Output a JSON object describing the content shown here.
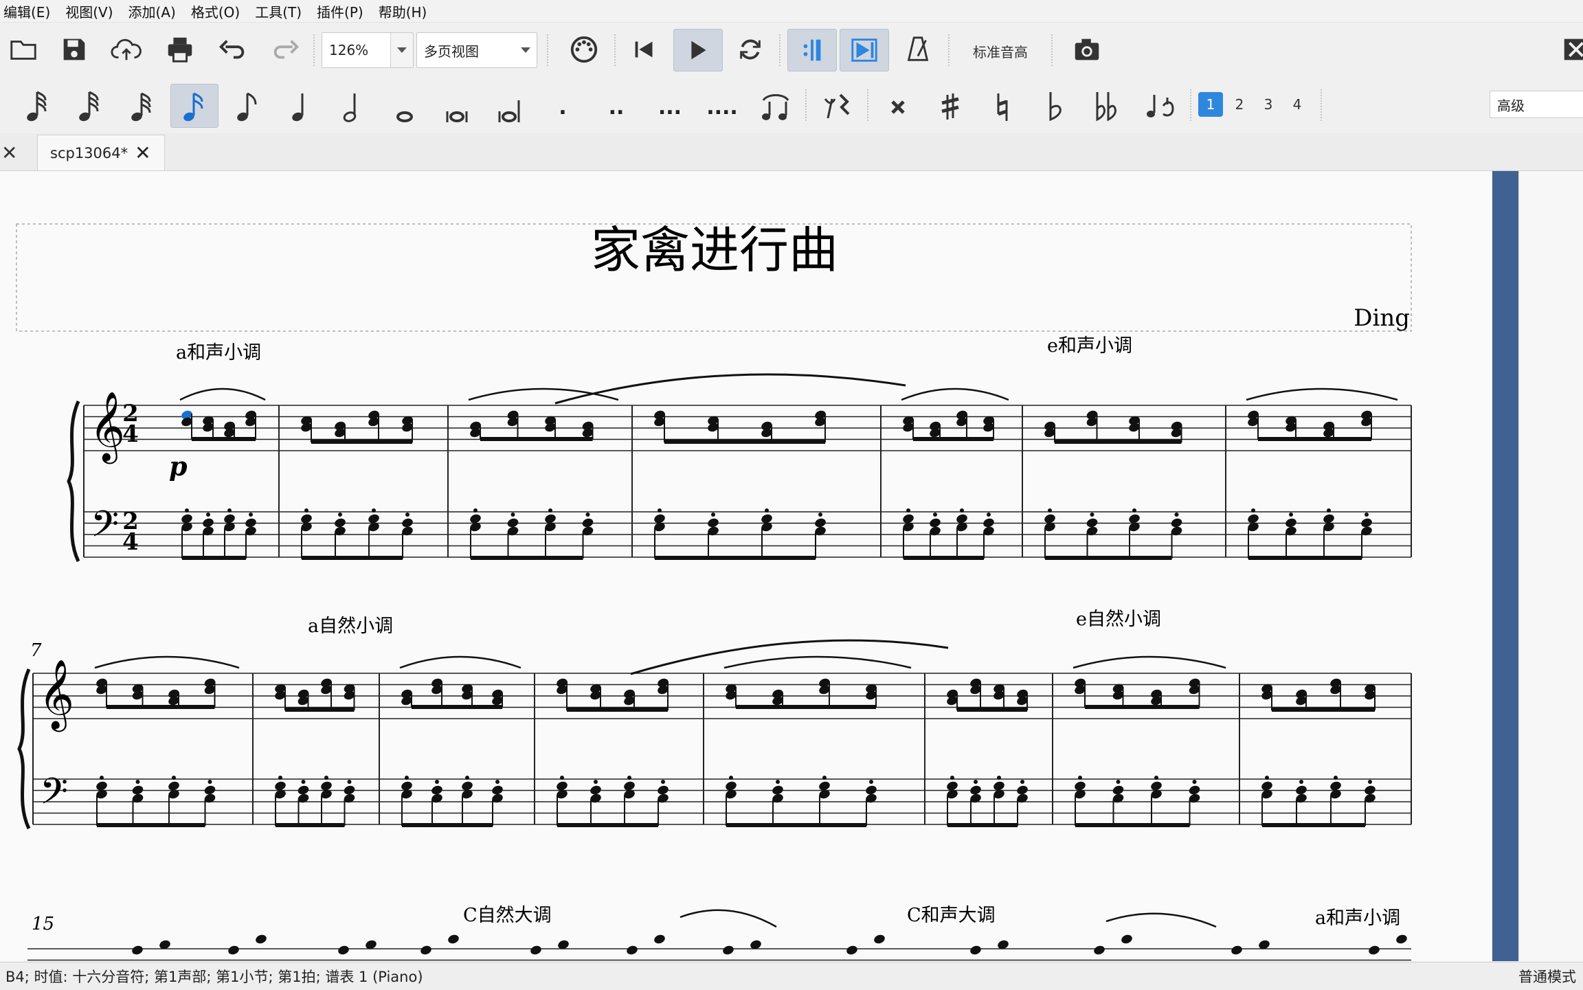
{
  "menubar": {
    "items": [
      "编辑(E)",
      "视图(V)",
      "添加(A)",
      "格式(O)",
      "工具(T)",
      "插件(P)",
      "帮助(H)"
    ]
  },
  "toolbar": {
    "zoom": "126%",
    "view_mode": "多页视图",
    "pitch_label": "标准音高"
  },
  "note_toolbar": {
    "dots": [
      ".",
      "..",
      "...",
      "...."
    ],
    "voices": [
      "1",
      "2",
      "3",
      "4"
    ],
    "active_voice": "1",
    "advanced": "高级"
  },
  "tabs": {
    "active": {
      "label": "scp13064*"
    }
  },
  "score": {
    "title": "家禽进行曲",
    "composer": "Ding",
    "dynamic": "p",
    "time_signature": [
      "2",
      "4"
    ],
    "measure_numbers": [
      "7",
      "15"
    ],
    "key_annotations": [
      "a和声小调",
      "e和声小调",
      "a自然小调",
      "e自然小调",
      "C自然大调",
      "C和声大调",
      "a和声小调"
    ]
  },
  "statusbar": {
    "info": "B4; 时值: 十六分音符; 第1声部;  第1小节; 第1拍; 谱表 1 (Piano)",
    "mode": "普通模式"
  },
  "colors": {
    "accent": "#2e86de",
    "selected_note": "#1a6fd0",
    "scroll_panel": "#3f6292"
  }
}
